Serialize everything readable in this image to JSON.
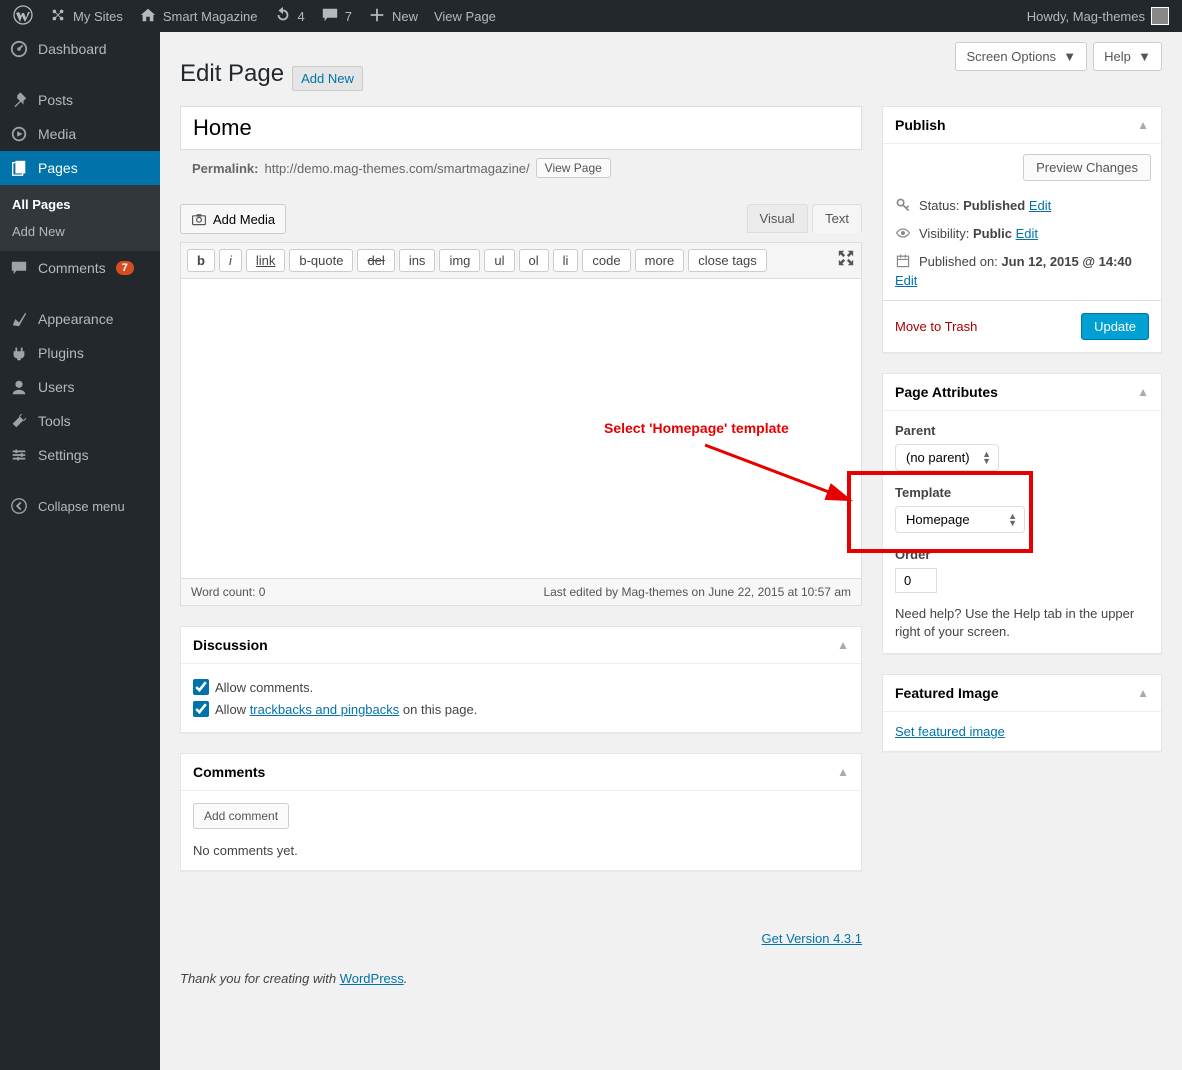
{
  "adminbar": {
    "my_sites": "My Sites",
    "site_name": "Smart Magazine",
    "updates": "4",
    "comments": "7",
    "new_label": "New",
    "view_page": "View Page",
    "howdy": "Howdy, Mag-themes"
  },
  "sidebar": {
    "dashboard": "Dashboard",
    "posts": "Posts",
    "media": "Media",
    "pages": "Pages",
    "all_pages": "All Pages",
    "add_new": "Add New",
    "comments": "Comments",
    "comments_count": "7",
    "appearance": "Appearance",
    "plugins": "Plugins",
    "users": "Users",
    "tools": "Tools",
    "settings": "Settings",
    "collapse": "Collapse menu"
  },
  "header": {
    "screen_options": "Screen Options",
    "help": "Help",
    "title": "Edit Page",
    "add_new": "Add New"
  },
  "editor": {
    "page_title_value": "Home",
    "permalink_label": "Permalink:",
    "permalink_url": "http://demo.mag-themes.com/smartmagazine/",
    "view_page_btn": "View Page",
    "add_media": "Add Media",
    "tab_visual": "Visual",
    "tab_text": "Text",
    "buttons": {
      "b": "b",
      "i": "i",
      "link": "link",
      "bquote": "b-quote",
      "del": "del",
      "ins": "ins",
      "img": "img",
      "ul": "ul",
      "ol": "ol",
      "li": "li",
      "code": "code",
      "more": "more",
      "close": "close tags"
    },
    "word_count": "Word count: 0",
    "last_edited": "Last edited by Mag-themes on June 22, 2015 at 10:57 am"
  },
  "discussion": {
    "title": "Discussion",
    "allow_comments": "Allow comments.",
    "allow_trackbacks_pre": "Allow ",
    "allow_trackbacks_link": "trackbacks and pingbacks",
    "allow_trackbacks_post": " on this page."
  },
  "comments_box": {
    "title": "Comments",
    "add_comment": "Add comment",
    "no_comments": "No comments yet."
  },
  "publish": {
    "title": "Publish",
    "preview": "Preview Changes",
    "status_label": "Status: ",
    "status_value": "Published",
    "visibility_label": "Visibility: ",
    "visibility_value": "Public",
    "published_label": "Published on: ",
    "published_value": "Jun 12, 2015 @ 14:40",
    "edit": "Edit",
    "trash": "Move to Trash",
    "update": "Update"
  },
  "page_attributes": {
    "title": "Page Attributes",
    "parent_label": "Parent",
    "parent_value": "(no parent)",
    "template_label": "Template",
    "template_value": "Homepage",
    "order_label": "Order",
    "order_value": "0",
    "help_text": "Need help? Use the Help tab in the upper right of your screen."
  },
  "featured_image": {
    "title": "Featured Image",
    "link": "Set featured image"
  },
  "annotation": {
    "text": "Select 'Homepage' template"
  },
  "footer": {
    "thanks": "Thank you for creating with ",
    "wp": "WordPress",
    "version": "Get Version 4.3.1"
  }
}
